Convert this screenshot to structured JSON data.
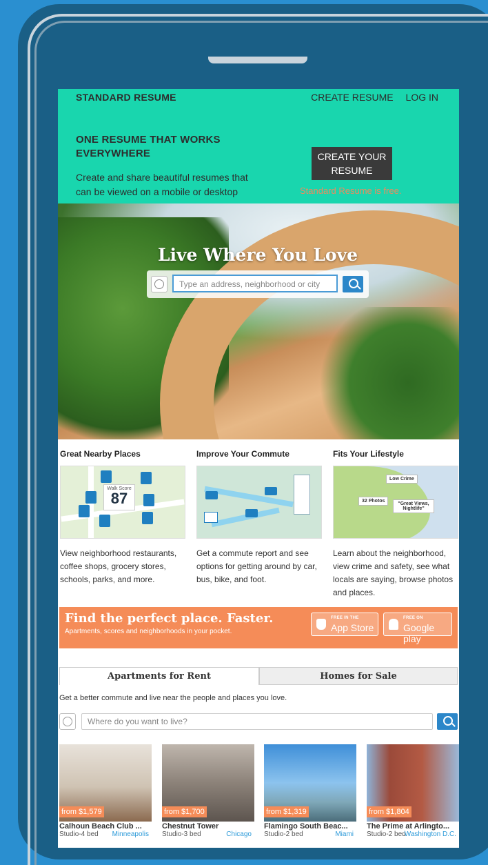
{
  "standard_resume": {
    "brand": "STANDARD RESUME",
    "nav": [
      "CREATE RESUME",
      "LOG IN"
    ],
    "heading": "ONE RESUME THAT WORKS EVERYWHERE",
    "body": "Create and share beautiful resumes that can be viewed on a mobile or desktop",
    "cta": "CREATE YOUR RESUME",
    "note": "Standard Resume is free."
  },
  "hero": {
    "title": "Live Where You Love",
    "search_placeholder": "Type an address, neighborhood or city"
  },
  "features": [
    {
      "title": "Great Nearby Places",
      "text": "View neighborhood restaurants, coffee shops, grocery stores, schools, parks, and more.",
      "badge_label": "Walk Score",
      "badge_value": "87"
    },
    {
      "title": "Improve Your Commute",
      "text": "Get a commute report and see options for getting around by car, bus, bike, and foot."
    },
    {
      "title": "Fits Your Lifestyle",
      "text": "Learn about the neighborhood, view crime and safety, see what locals are saying, browse photos and places.",
      "tags": [
        "Low Crime",
        "32 Photos",
        "\"Great Views, Nightlife\""
      ]
    }
  ],
  "promo": {
    "title": "Find the perfect place. Faster.",
    "subtitle": "Apartments, scores and neighborhoods in your pocket.",
    "app_store_small": "FREE IN THE",
    "app_store": "App Store",
    "google_small": "FREE ON",
    "google": "Google play"
  },
  "tabs": [
    "Apartments for Rent",
    "Homes for Sale"
  ],
  "search2": {
    "subtitle": "Get a better commute and live near the people and places you love.",
    "placeholder": "Where do you want to live?"
  },
  "listings": [
    {
      "price": "from $1,579",
      "name": "Calhoun Beach Club ...",
      "meta": "Studio-4 bed",
      "city": "Minneapolis"
    },
    {
      "price": "from $1,700",
      "name": "Chestnut Tower",
      "meta": "Studio-3 bed",
      "city": "Chicago"
    },
    {
      "price": "from $1,319",
      "name": "Flamingo South Beac...",
      "meta": "Studio-2 bed",
      "city": "Miami"
    },
    {
      "price": "from $1,804",
      "name": "The Prime at Arlingto...",
      "meta": "Studio-2 bed",
      "city": "Washington D.C."
    }
  ],
  "colors": {
    "accent_green": "#19d6ae",
    "accent_orange": "#f58c58",
    "link_blue": "#2c87c9"
  }
}
